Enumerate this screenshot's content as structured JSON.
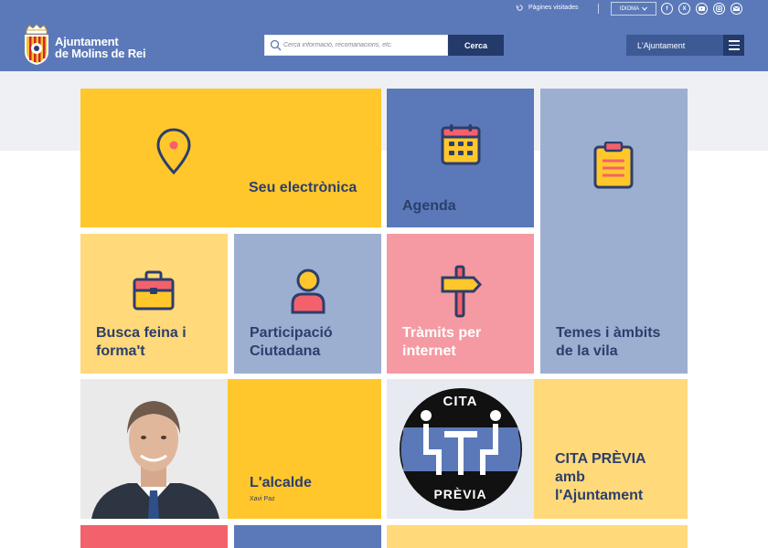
{
  "topbar": {
    "visited_label": "Pàgines visitades",
    "language_label": "IDIOMA",
    "social_icons": [
      "facebook-icon",
      "x-icon",
      "youtube-icon",
      "instagram-icon",
      "email-icon"
    ]
  },
  "header": {
    "brand_line1": "Ajuntament",
    "brand_line2": "de Molins de Rei",
    "search_placeholder": "Cerca informació, recomanacions, etc.",
    "search_button": "Cerca",
    "ajuntament_button": "L'Ajuntament"
  },
  "tiles": {
    "seu": "Seu electrònica",
    "agenda": "Agenda",
    "temes": "Temes i àmbits de la vila",
    "feina": "Busca feina i forma't",
    "participacio": "Participació Ciutadana",
    "tramits": "Tràmits per internet",
    "alcalde": "L'alcalde",
    "alcalde_name": "Xavi Paz",
    "cita_badge_top": "CITA",
    "cita_badge_bottom": "PRÈVIA",
    "cita": "CITA PRÈVIA amb l'Ajuntament"
  },
  "colors": {
    "header_blue": "#5b79b9",
    "navy": "#233a6a",
    "yellow": "#ffc72c",
    "light_yellow": "#ffd97a",
    "light_blue": "#9cafd1",
    "pink": "#f59aa2",
    "text_navy": "#2c3e6c"
  }
}
